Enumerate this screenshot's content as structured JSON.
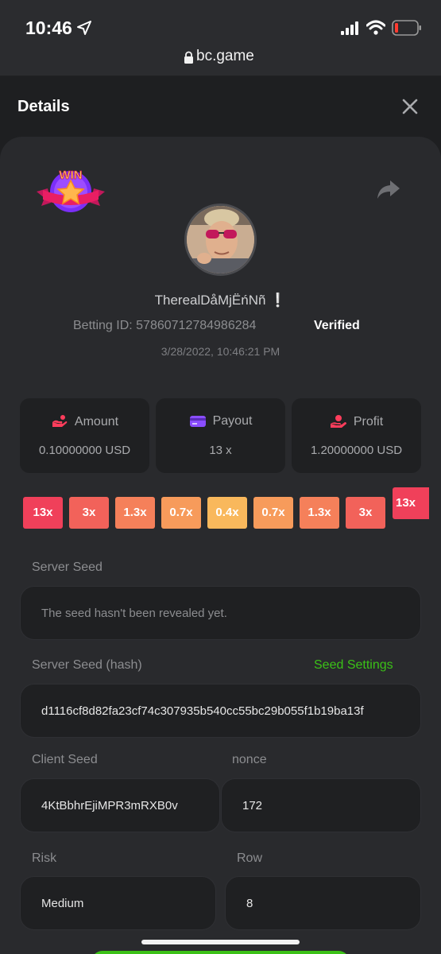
{
  "status_bar": {
    "time": "10:46"
  },
  "browser": {
    "url": "bc.game"
  },
  "modal": {
    "title": "Details"
  },
  "player": {
    "name": "TherealDåMjËńNñ ❕",
    "betting_id_label": "Betting ID: 57860712784986284",
    "verified": "Verified",
    "timestamp": "3/28/2022, 10:46:21 PM"
  },
  "badge": {
    "text": "WIN"
  },
  "stats": [
    {
      "label": "Amount",
      "value": "0.10000000 USD",
      "icon": "amount-icon"
    },
    {
      "label": "Payout",
      "value": "13 x",
      "icon": "card-icon"
    },
    {
      "label": "Profit",
      "value": "1.20000000 USD",
      "icon": "profit-icon"
    }
  ],
  "multipliers": [
    {
      "label": "13x",
      "color": "#f0405a"
    },
    {
      "label": "3x",
      "color": "#f2625a"
    },
    {
      "label": "1.3x",
      "color": "#f5805a"
    },
    {
      "label": "0.7x",
      "color": "#f79b5b"
    },
    {
      "label": "0.4x",
      "color": "#f9b85c"
    },
    {
      "label": "0.7x",
      "color": "#f79b5b"
    },
    {
      "label": "1.3x",
      "color": "#f5805a"
    },
    {
      "label": "3x",
      "color": "#f2625a"
    },
    {
      "label": "13x",
      "color": "#f0405a"
    }
  ],
  "server_seed": {
    "label": "Server Seed",
    "value": "The seed hasn't been revealed yet."
  },
  "server_seed_hash": {
    "label": "Server Seed (hash)",
    "value": "d1116cf8d82fa23cf74c307935b540cc55bc29b055f1b19ba13f",
    "settings_link": "Seed Settings"
  },
  "client_seed": {
    "label": "Client Seed",
    "value": "4KtBbhrEjiMPR3mRXB0v"
  },
  "nonce": {
    "label": "nonce",
    "value": "172"
  },
  "risk": {
    "label": "Risk",
    "value": "Medium"
  },
  "row": {
    "label": "Row",
    "value": "8"
  },
  "colors": {
    "accent_green": "#3bc117",
    "background": "#1e1f21",
    "card": "#292a2d"
  }
}
